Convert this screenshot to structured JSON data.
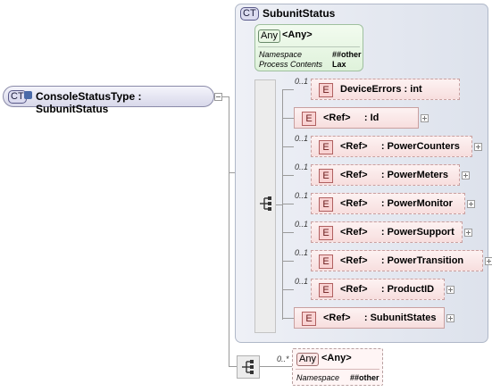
{
  "root": {
    "badge": "CT",
    "label": "ConsoleStatusType : SubunitStatus"
  },
  "complex_type": {
    "badge": "CT",
    "title": "SubunitStatus",
    "any": {
      "badge": "Any",
      "title": "<Any>",
      "namespace_key": "Namespace",
      "namespace_val": "##other",
      "process_key": "Process Contents",
      "process_val": "Lax"
    }
  },
  "sequence_elements": [
    {
      "occ": "0..1",
      "badge": "E",
      "label": "DeviceErrors : int",
      "optional": true
    },
    {
      "occ": "",
      "badge": "E",
      "label": "<Ref>     : Id",
      "optional": false
    },
    {
      "occ": "0..1",
      "badge": "E",
      "label": "<Ref>     : PowerCounters",
      "optional": true
    },
    {
      "occ": "0..1",
      "badge": "E",
      "label": "<Ref>     : PowerMeters",
      "optional": true
    },
    {
      "occ": "0..1",
      "badge": "E",
      "label": "<Ref>     : PowerMonitor",
      "optional": true
    },
    {
      "occ": "0..1",
      "badge": "E",
      "label": "<Ref>     : PowerSupport",
      "optional": true
    },
    {
      "occ": "0..1",
      "badge": "E",
      "label": "<Ref>     : PowerTransition",
      "optional": true
    },
    {
      "occ": "0..1",
      "badge": "E",
      "label": "<Ref>     : ProductID",
      "optional": true
    },
    {
      "occ": "",
      "badge": "E",
      "label": "<Ref>     : SubunitStates",
      "optional": false
    }
  ],
  "extension_any": {
    "occ": "0..*",
    "badge": "Any",
    "title": "<Any>",
    "namespace_key": "Namespace",
    "namespace_val": "##other"
  }
}
